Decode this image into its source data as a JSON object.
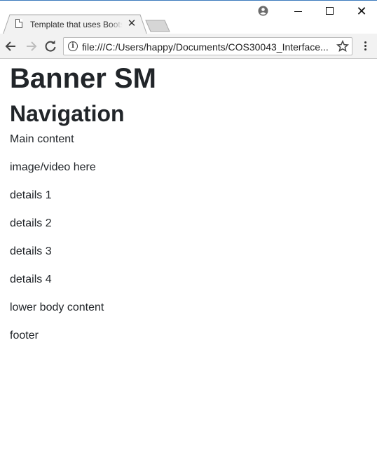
{
  "browser": {
    "tab_title": "Template that uses Bootstrap",
    "url": "file:///C:/Users/happy/Documents/COS30043_Interface..."
  },
  "page": {
    "banner": "Banner SM",
    "navigation": "Navigation",
    "paragraphs": [
      "Main content",
      "image/video here",
      "details 1",
      "details 2",
      "details 3",
      "details 4",
      "lower body content",
      "footer"
    ]
  }
}
